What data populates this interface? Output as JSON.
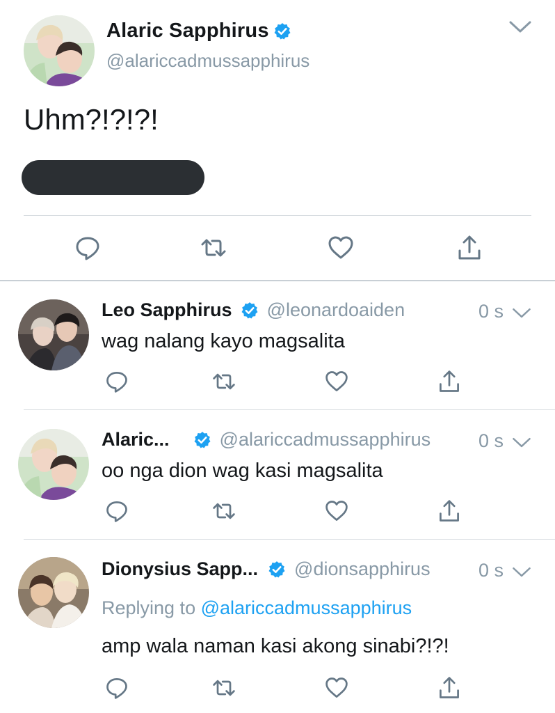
{
  "main_tweet": {
    "name": "Alaric Sapphirus",
    "handle": "@alariccadmussapphirus",
    "text": "Uhm?!?!?!",
    "verified": true
  },
  "replies": [
    {
      "name": "Leo Sapphirus",
      "handle": "@leonardoaiden",
      "time": "0 s",
      "text": "wag nalang kayo magsalita"
    },
    {
      "name": "Alaric...",
      "handle": "@alariccadmussapphirus",
      "time": "0 s",
      "text": "oo nga dion wag kasi magsalita"
    },
    {
      "name": "Dionysius Sapp...",
      "handle": "@dionsapphirus",
      "time": "0 s",
      "replying_prefix": "Replying to ",
      "replying_to": "@alariccadmussapphirus",
      "text": "amp wala naman kasi akong sinabi?!?!"
    }
  ],
  "icons": {
    "reply": "reply-icon",
    "retweet": "retweet-icon",
    "like": "heart-icon",
    "share": "share-icon",
    "verified": "verified-badge-icon",
    "more": "chevron-down-icon"
  },
  "colors": {
    "text": "#14171a",
    "secondary": "#8899a6",
    "accent": "#1da1f2",
    "icon": "#657786",
    "divider": "#d8dde1",
    "redacted": "#2b2f33"
  }
}
